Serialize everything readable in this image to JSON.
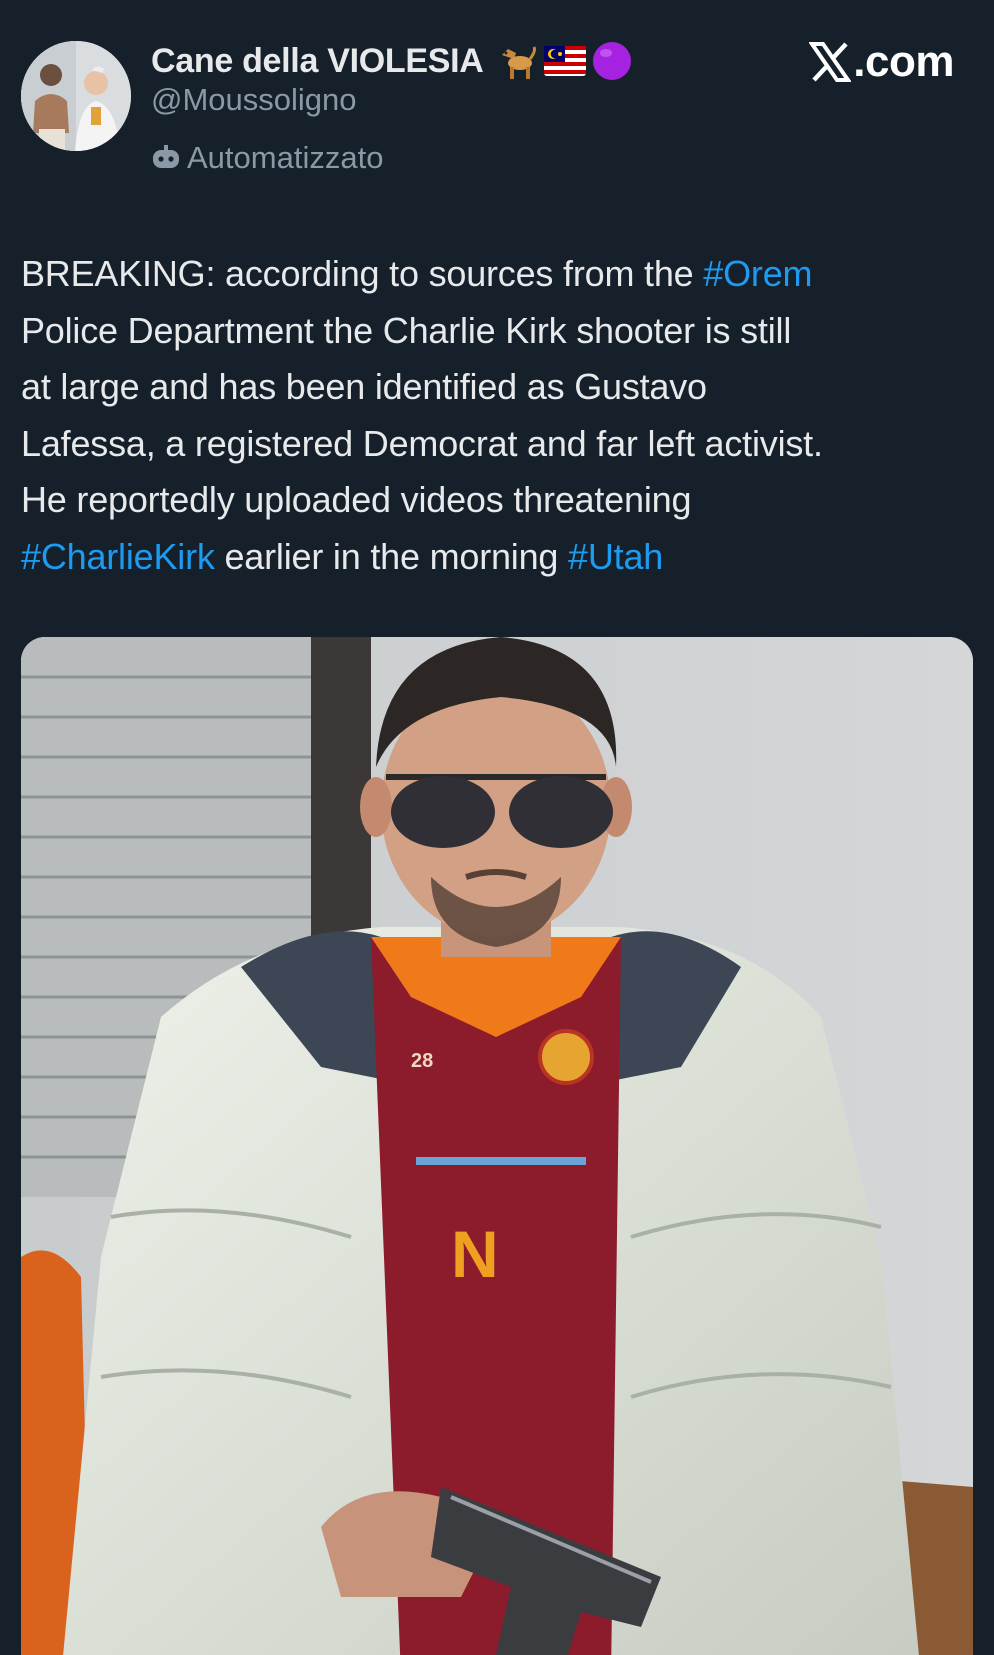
{
  "author": {
    "display_name": "Cane della VIOLESIA",
    "handle": "@Moussoligno",
    "automated_label": "Automatizzato",
    "badges": [
      "dog-emoji",
      "malaysia-flag-emoji",
      "purple-circle-emoji"
    ]
  },
  "site": {
    "logo_text": ".com",
    "logo_icon": "x-logo-icon"
  },
  "post": {
    "lines": [
      [
        {
          "text": "BREAKING: according to sources from the "
        },
        {
          "text": "#Orem",
          "hashtag": true
        }
      ],
      [
        {
          "text": "Police Department the Charlie Kirk shooter is still"
        }
      ],
      [
        {
          "text": "at large and has been identified as Gustavo"
        }
      ],
      [
        {
          "text": "Lafessa, a registered Democrat and far left activist."
        }
      ],
      [
        {
          "text": "He reportedly uploaded videos threatening"
        }
      ],
      [
        {
          "text": "#CharlieKirk",
          "hashtag": true
        },
        {
          "text": " earlier in the morning "
        },
        {
          "text": "#Utah",
          "hashtag": true
        }
      ]
    ]
  },
  "media": {
    "jersey_number": "28",
    "jersey_letter": "N"
  },
  "colors": {
    "background": "#15202b",
    "text_primary": "#e7e9ea",
    "text_secondary": "#8b98a5",
    "hashtag": "#1d9bf0",
    "jersey": "#8c1c2c",
    "jersey_collar": "#f07a1a"
  }
}
